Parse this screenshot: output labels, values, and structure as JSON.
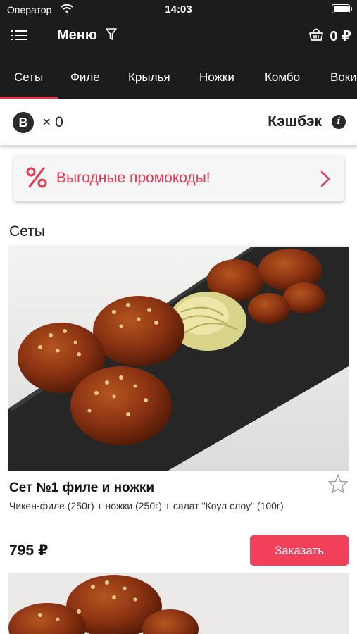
{
  "status_bar": {
    "carrier": "Оператор",
    "time": "14:03"
  },
  "nav": {
    "title": "Меню",
    "cart_amount": "0 ₽"
  },
  "tabs": [
    {
      "label": "Сеты",
      "active": true
    },
    {
      "label": "Филе"
    },
    {
      "label": "Крылья"
    },
    {
      "label": "Ножки"
    },
    {
      "label": "Комбо"
    },
    {
      "label": "Воки"
    }
  ],
  "cashback": {
    "badge": "B",
    "count": "× 0",
    "label": "Кэшбэк",
    "info": "i"
  },
  "promo": {
    "text": "Выгодные промокоды!"
  },
  "section": {
    "title": "Сеты"
  },
  "products": [
    {
      "name": "Сет №1 филе и ножки",
      "description": "Чикен-филе (250г) + ножки (250г) + салат \"Коул слоу\" (100г)",
      "price": "795 ₽",
      "order_label": "Заказать"
    }
  ],
  "colors": {
    "accent": "#f2405b",
    "header_bg": "#1c1c1e",
    "promo_text": "#e8364f"
  },
  "icons": [
    "wifi-icon",
    "battery-icon",
    "menu-list-icon",
    "filter-icon",
    "cart-basket-icon",
    "bonus-badge-icon",
    "info-icon",
    "percent-icon",
    "chevron-right-icon",
    "star-outline-icon"
  ]
}
